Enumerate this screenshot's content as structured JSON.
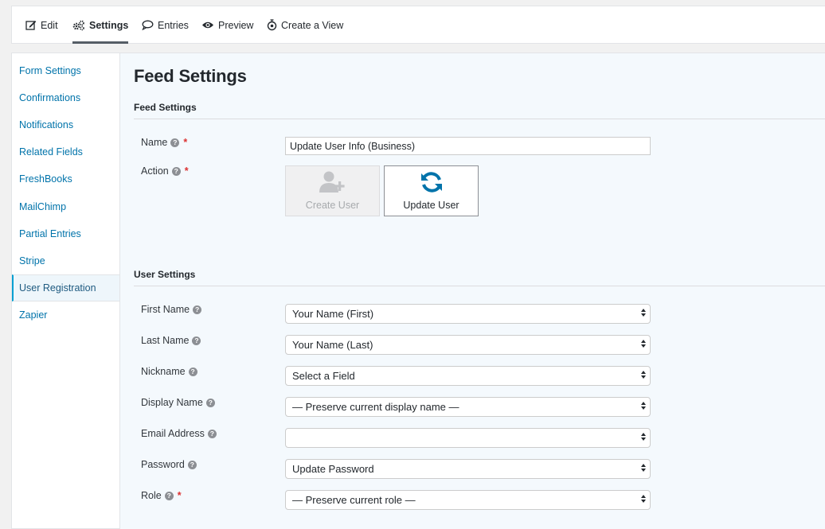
{
  "toolbar": {
    "items": [
      {
        "label": "Edit",
        "icon": "edit-icon"
      },
      {
        "label": "Settings",
        "icon": "gears-icon",
        "active": true
      },
      {
        "label": "Entries",
        "icon": "comment-icon"
      },
      {
        "label": "Preview",
        "icon": "eye-icon"
      },
      {
        "label": "Create a View",
        "icon": "gravityview-icon"
      }
    ]
  },
  "sidebar": {
    "items": [
      {
        "label": "Form Settings"
      },
      {
        "label": "Confirmations"
      },
      {
        "label": "Notifications"
      },
      {
        "label": "Related Fields"
      },
      {
        "label": "FreshBooks"
      },
      {
        "label": "MailChimp"
      },
      {
        "label": "Partial Entries"
      },
      {
        "label": "Stripe"
      },
      {
        "label": "User Registration",
        "active": true
      },
      {
        "label": "Zapier"
      }
    ]
  },
  "main": {
    "title": "Feed Settings",
    "feed_section": {
      "title": "Feed Settings",
      "name_label": "Name",
      "name_value": "Update User Info (Business)",
      "action_label": "Action",
      "actions": [
        {
          "label": "Create User",
          "state": "disabled"
        },
        {
          "label": "Update User",
          "state": "selected"
        }
      ]
    },
    "user_section": {
      "title": "User Settings",
      "fields": [
        {
          "label": "First Name",
          "value": "Your Name (First)",
          "required": false
        },
        {
          "label": "Last Name",
          "value": "Your Name (Last)",
          "required": false
        },
        {
          "label": "Nickname",
          "value": "Select a Field",
          "required": false
        },
        {
          "label": "Display Name",
          "value": "— Preserve current display name —",
          "required": false
        },
        {
          "label": "Email Address",
          "value": "",
          "required": false
        },
        {
          "label": "Password",
          "value": "Update Password",
          "required": false
        },
        {
          "label": "Role",
          "value": "— Preserve current role —",
          "required": true
        }
      ]
    },
    "help_glyph": "?",
    "required_glyph": "*"
  },
  "colors": {
    "link": "#0073aa",
    "required": "#dc3232",
    "update_icon": "#0073aa",
    "main_bg": "#f4f9fd"
  }
}
